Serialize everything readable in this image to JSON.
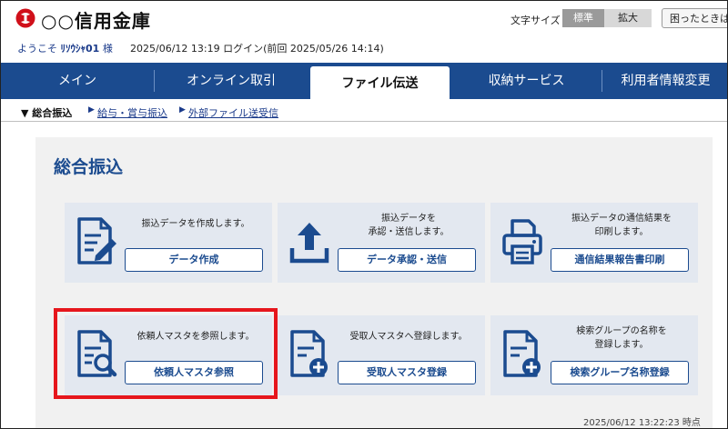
{
  "header": {
    "bank_name": "○○信用金庫",
    "welcome_prefix": "ようこそ",
    "user_name": "ﾘｿｳｼｬ01",
    "welcome_suffix": "様",
    "login_info": "2025/06/12 13:19 ログイン(前回 2025/05/26 14:14)",
    "font_size_label": "文字サイズ",
    "font_size_normal": "標準",
    "font_size_large": "拡大",
    "help_label": "困ったときは"
  },
  "nav": {
    "items": [
      "メイン",
      "オンライン取引",
      "ファイル伝送",
      "収納サービス",
      "利用者情報変更"
    ],
    "active": "ファイル伝送"
  },
  "subnav": {
    "current": "▼ 総合振込",
    "links": [
      "給与・賞与振込",
      "外部ファイル送受信"
    ]
  },
  "page_title": "総合振込",
  "cards": [
    {
      "icon": "document-edit-icon",
      "desc": "振込データを作成します。",
      "button": "データ作成"
    },
    {
      "icon": "upload-icon",
      "desc1": "振込データを",
      "desc2": "承認・送信します。",
      "button": "データ承認・送信"
    },
    {
      "icon": "printer-icon",
      "desc1": "振込データの通信結果を",
      "desc2": "印刷します。",
      "button": "通信結果報告書印刷"
    },
    {
      "icon": "document-search-icon",
      "desc": "依頼人マスタを参照します。",
      "button": "依頼人マスタ参照"
    },
    {
      "icon": "document-add-icon",
      "desc": "受取人マスタへ登録します。",
      "button": "受取人マスタ登録"
    },
    {
      "icon": "document-add-icon",
      "desc1": "検索グループの名称を",
      "desc2": "登録します。",
      "button": "検索グループ名称登録"
    }
  ],
  "timestamp": "2025/06/12 13:22:23 時点",
  "colors": {
    "brand": "#1b4b8f",
    "highlight": "#e6161c",
    "logo": "#d0101a"
  }
}
